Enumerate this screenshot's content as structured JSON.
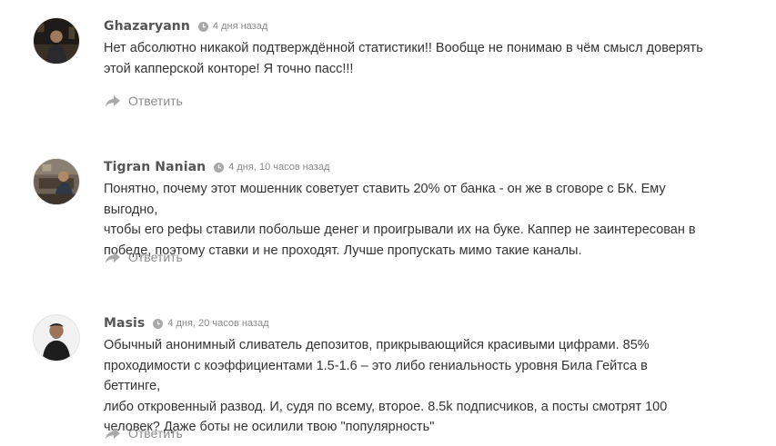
{
  "comments": [
    {
      "author": "Ghazaryann",
      "date": "4 дня назад",
      "lines": [
        "Нет абсолютно никакой подтверждённой статистики!! Вообще не понимаю в чём смысл доверять",
        "этой капперской конторе! Я точно пасс!!!"
      ],
      "reply_label": "Ответить"
    },
    {
      "author": "Tigran Nanian",
      "date": "4 дня, 10 часов назад",
      "lines": [
        "Понятно, почему этот мошенник советует ставить 20% от банка - он же в сговоре с БК. Ему выгодно,",
        "чтобы его рефы ставили побольше денег и проигрывали их на буке. Каппер не заинтересован в",
        "победе, поэтому ставки и не проходят. Лучше пропускать мимо такие каналы."
      ],
      "reply_label": "Ответить"
    },
    {
      "author": "Masis",
      "date": "4 дня, 20 часов назад",
      "lines": [
        "Обычный анонимный сливатель депозитов, прикрывающийся красивыми цифрами. 85%",
        "проходимости с коэффициентами 1.5-1.6 – это либо гениальность уровня Била Гейтса в беттинге,",
        "либо откровенный развод. И, судя по всему, второе. 8.5k подписчиков, а посты смотрят 100",
        "человек? Даже боты не осилили твою \"популярность\""
      ],
      "reply_label": "Ответить"
    }
  ],
  "icons": {
    "clock": "clock-icon",
    "reply": "reply-arrow-icon"
  },
  "colors": {
    "author": "#555555",
    "text": "#333333",
    "muted": "#8c8c8c",
    "icon": "#a9a9a9"
  }
}
